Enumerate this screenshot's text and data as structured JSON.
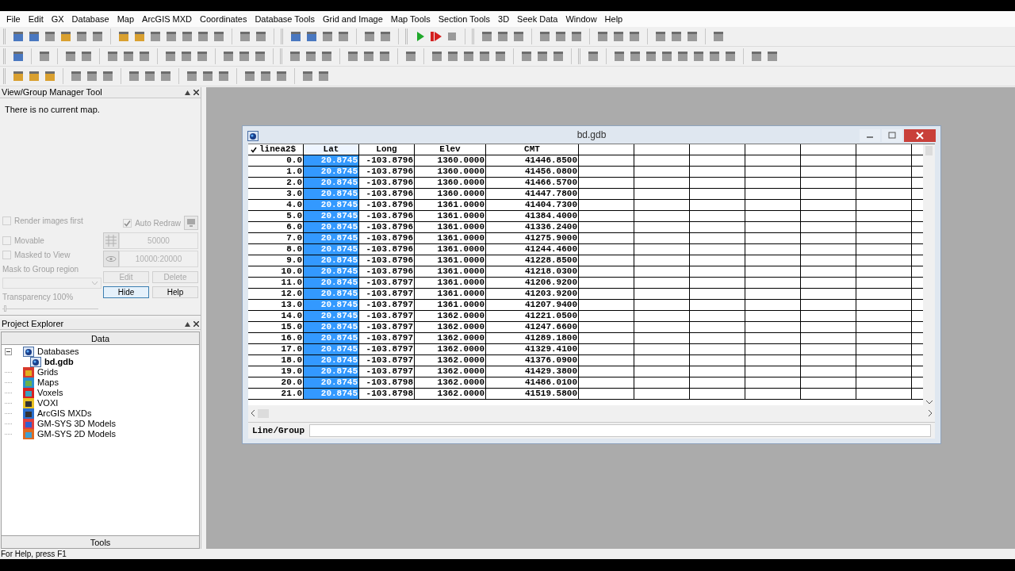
{
  "menu_bar": [
    "File",
    "Edit",
    "GX",
    "Database",
    "Map",
    "ArcGIS MXD",
    "Coordinates",
    "Database Tools",
    "Grid and Image",
    "Map Tools",
    "Section Tools",
    "3D",
    "Seek Data",
    "Window",
    "Help"
  ],
  "view_group_manager": {
    "title": "View/Group Manager Tool",
    "message": "There is no current map.",
    "checkboxes": [
      {
        "label": "Render images first",
        "checked": false,
        "disabled": true
      },
      {
        "label": "Auto Redraw",
        "checked": true,
        "disabled": true
      },
      {
        "label": "Movable",
        "checked": false,
        "disabled": true
      },
      {
        "label": "Masked to View",
        "checked": false,
        "disabled": true
      }
    ],
    "mask_label": "Mask to Group region",
    "transparency": {
      "label": "Transparency 100%",
      "level": 0
    },
    "scale_fields": [
      "50000",
      "10000:20000"
    ],
    "buttons": [
      {
        "label": "Edit",
        "disabled": true,
        "focused": false
      },
      {
        "label": "Delete",
        "disabled": true,
        "focused": false
      },
      {
        "label": "Hide",
        "disabled": false,
        "focused": true
      },
      {
        "label": "Help",
        "disabled": false,
        "focused": false
      }
    ]
  },
  "project_explorer": {
    "title": "Project Explorer",
    "top_tab": "Data",
    "bottom_tab": "Tools",
    "tree": [
      {
        "label": "Databases",
        "expanded": true,
        "current": false,
        "children": [
          {
            "label": "bd.gdb",
            "current": true
          }
        ]
      },
      {
        "label": "Grids",
        "current": false
      },
      {
        "label": "Maps",
        "current": false
      },
      {
        "label": "Voxels",
        "current": false
      },
      {
        "label": "VOXI",
        "current": false
      },
      {
        "label": "ArcGIS MXDs",
        "current": false
      },
      {
        "label": "GM-SYS 3D Models",
        "current": false
      },
      {
        "label": "GM-SYS 2D Models",
        "current": false
      }
    ]
  },
  "database_window": {
    "title": "bd.gdb",
    "columns": [
      {
        "label": "linea2$",
        "selected": false,
        "checked": true
      },
      {
        "label": "Lat",
        "selected": true,
        "checked": false
      },
      {
        "label": "Long",
        "selected": false,
        "checked": false
      },
      {
        "label": "Elev",
        "selected": false,
        "checked": false
      },
      {
        "label": "CMT",
        "selected": false,
        "checked": false
      }
    ],
    "rows": [
      [
        "0.0",
        "20.8745",
        "-103.8796",
        "1360.0000",
        "41446.8500"
      ],
      [
        "1.0",
        "20.8745",
        "-103.8796",
        "1360.0000",
        "41456.0800"
      ],
      [
        "2.0",
        "20.8745",
        "-103.8796",
        "1360.0000",
        "41466.5700"
      ],
      [
        "3.0",
        "20.8745",
        "-103.8796",
        "1360.0000",
        "41447.7800"
      ],
      [
        "4.0",
        "20.8745",
        "-103.8796",
        "1361.0000",
        "41404.7300"
      ],
      [
        "5.0",
        "20.8745",
        "-103.8796",
        "1361.0000",
        "41384.4000"
      ],
      [
        "6.0",
        "20.8745",
        "-103.8796",
        "1361.0000",
        "41336.2400"
      ],
      [
        "7.0",
        "20.8745",
        "-103.8796",
        "1361.0000",
        "41275.9000"
      ],
      [
        "8.0",
        "20.8745",
        "-103.8796",
        "1361.0000",
        "41244.4600"
      ],
      [
        "9.0",
        "20.8745",
        "-103.8796",
        "1361.0000",
        "41228.8500"
      ],
      [
        "10.0",
        "20.8745",
        "-103.8796",
        "1361.0000",
        "41218.0300"
      ],
      [
        "11.0",
        "20.8745",
        "-103.8797",
        "1361.0000",
        "41206.9200"
      ],
      [
        "12.0",
        "20.8745",
        "-103.8797",
        "1361.0000",
        "41203.9200"
      ],
      [
        "13.0",
        "20.8745",
        "-103.8797",
        "1361.0000",
        "41207.9400"
      ],
      [
        "14.0",
        "20.8745",
        "-103.8797",
        "1362.0000",
        "41221.0500"
      ],
      [
        "15.0",
        "20.8745",
        "-103.8797",
        "1362.0000",
        "41247.6600"
      ],
      [
        "16.0",
        "20.8745",
        "-103.8797",
        "1362.0000",
        "41289.1800"
      ],
      [
        "17.0",
        "20.8745",
        "-103.8797",
        "1362.0000",
        "41329.4100"
      ],
      [
        "18.0",
        "20.8745",
        "-103.8797",
        "1362.0000",
        "41376.0900"
      ],
      [
        "19.0",
        "20.8745",
        "-103.8797",
        "1362.0000",
        "41429.3800"
      ],
      [
        "20.0",
        "20.8745",
        "-103.8798",
        "1362.0000",
        "41486.0100"
      ],
      [
        "21.0",
        "20.8745",
        "-103.8798",
        "1362.0000",
        "41519.5800"
      ]
    ],
    "line_group_label": "Line/Group"
  },
  "status_bar": "For Help, press F1"
}
